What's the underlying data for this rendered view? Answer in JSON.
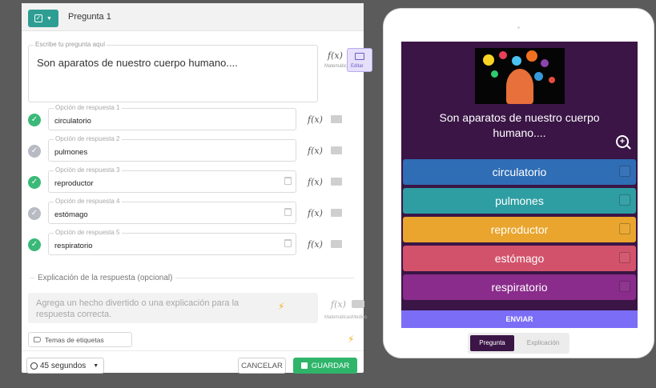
{
  "editor": {
    "header_title": "Pregunta 1",
    "question_legend": "Escribe tu pregunta aquí",
    "question_text": "Son aparatos de nuestro cuerpo humano....",
    "math_fx": "f(x)",
    "math_caption": "Matemáticas",
    "edit_caption": "Editar",
    "options": [
      {
        "legend": "Opción de respuesta 1",
        "value": "circulatorio",
        "correct": true
      },
      {
        "legend": "Opción de respuesta 2",
        "value": "pulmones",
        "correct": false
      },
      {
        "legend": "Opción de respuesta 3",
        "value": "reproductor",
        "correct": true
      },
      {
        "legend": "Opción de respuesta 4",
        "value": "estómago",
        "correct": false
      },
      {
        "legend": "Opción de respuesta 5",
        "value": "respiratorio",
        "correct": true
      }
    ],
    "explanation_title": "Explicación de la respuesta (opcional)",
    "explanation_placeholder": "Agrega un hecho divertido o una explicación para la respuesta correcta.",
    "explanation_math_caption": "Matemáticas",
    "explanation_media_caption": "Medios",
    "tags_label": "Temas de etiquetas",
    "time_label": "45 segundos",
    "cancel_label": "CANCELAR",
    "save_label": "GUARDAR"
  },
  "preview": {
    "question_text": "Son aparatos de nuestro cuerpo humano....",
    "answers": [
      {
        "label": "circulatorio",
        "color": "#2f6db5"
      },
      {
        "label": "pulmones",
        "color": "#2e9ea3"
      },
      {
        "label": "reproductor",
        "color": "#e9a52d"
      },
      {
        "label": "estómago",
        "color": "#d2526b"
      },
      {
        "label": "respiratorio",
        "color": "#8a2c8b"
      }
    ],
    "send_label": "ENVIAR",
    "tab_question": "Pregunta",
    "tab_explanation": "Explicación"
  },
  "colors": {
    "accent": "#2e9e93",
    "correct": "#3ab978",
    "save": "#2fb56a",
    "preview_bg": "#3a1546",
    "send": "#7b6df5"
  },
  "icons": [
    "checkbox-icon",
    "chevron-down-icon",
    "math-fx-icon",
    "image-icon",
    "check-icon",
    "trash-icon",
    "bolt-icon",
    "media-icon",
    "tag-icon",
    "clock-icon",
    "save-disk-icon",
    "zoom-in-icon"
  ]
}
